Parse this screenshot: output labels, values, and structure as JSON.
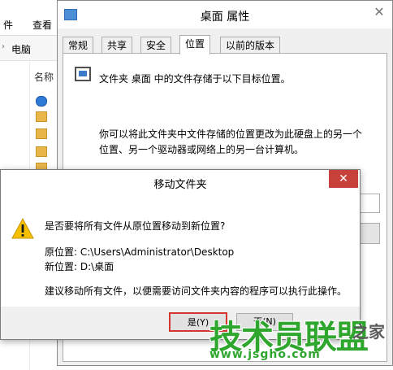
{
  "explorer": {
    "tabs": [
      "件",
      "查看"
    ],
    "breadcrumb": "电脑",
    "column_name": "名称"
  },
  "properties": {
    "title": "桌面 属性",
    "close": "✕",
    "tabs": [
      "常规",
      "共享",
      "安全",
      "位置",
      "以前的版本"
    ],
    "active_tab": "位置",
    "location_description": "文件夹 桌面 中的文件存储于以下目标位置。",
    "info_line1": "你可以将此文件夹中文件存储的位置更改为此硬盘上的另一个",
    "info_line2": "位置、另一个驱动器或网络上的另一台计算机。"
  },
  "move_dialog": {
    "title": "移动文件夹",
    "close": "✕",
    "question": "是否要将所有文件从原位置移动到新位置?",
    "original_location": "原位置: C:\\Users\\Administrator\\Desktop",
    "new_location": "新位置: D:\\桌面",
    "advice": "建议移动所有文件，以便需要访问文件夹内容的程序可以执行此操作。",
    "yes_label": "是(Y)",
    "no_label": "否(N)"
  },
  "watermark": {
    "brand": "技术员联盟",
    "site": "www.jsgho.com",
    "home": "之家"
  },
  "colors": {
    "warning": "#f5c000",
    "highlight": "#d4362f",
    "watermark": "#2fa62e",
    "close_red": "#c7413a"
  }
}
